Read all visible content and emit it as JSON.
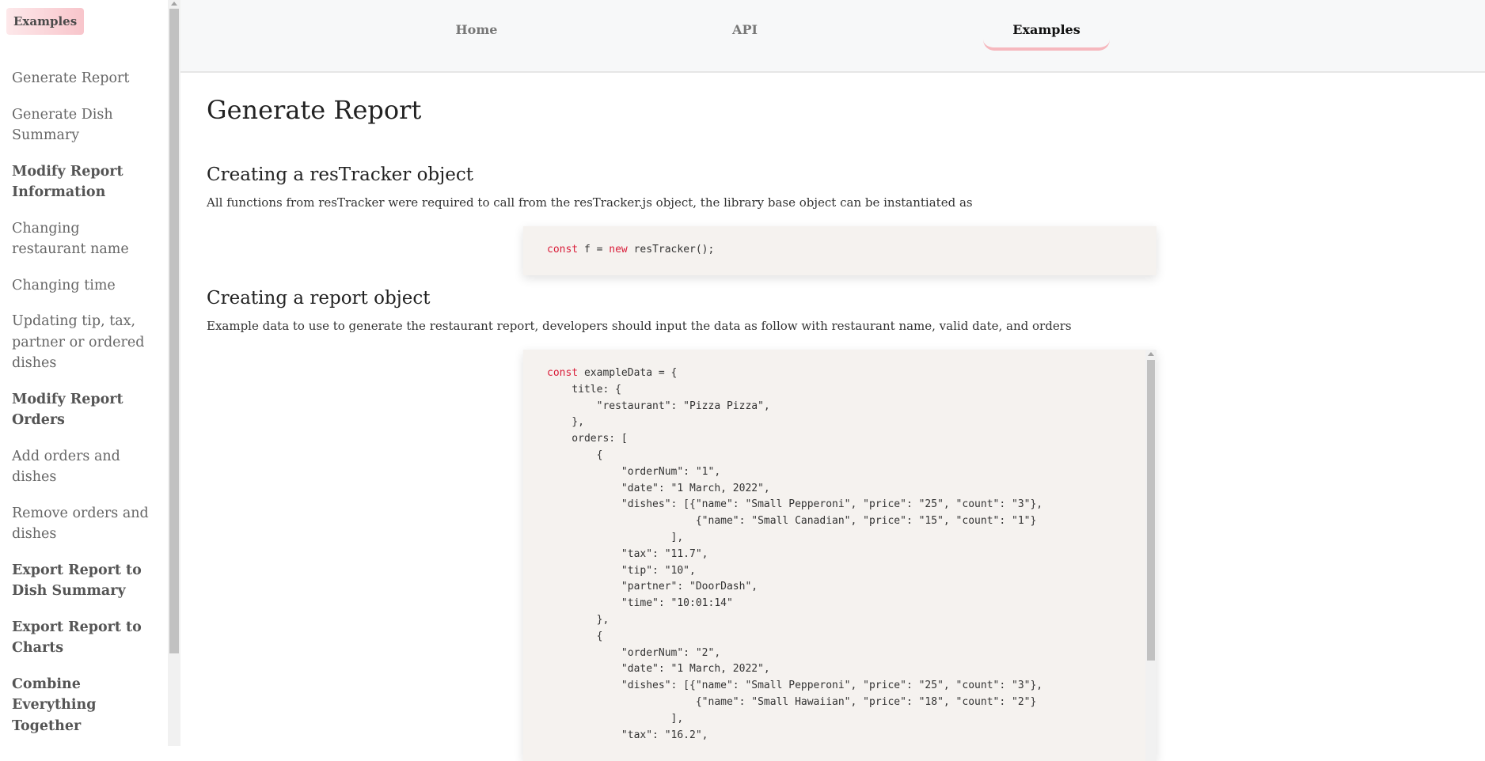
{
  "sidebar": {
    "badge": "Examples",
    "items": [
      {
        "label": "Generate Report",
        "section": false
      },
      {
        "label": "Generate Dish Summary",
        "section": false
      },
      {
        "label": "Modify Report Information",
        "section": true
      },
      {
        "label": "Changing restaurant name",
        "section": false
      },
      {
        "label": "Changing time",
        "section": false
      },
      {
        "label": "Updating tip, tax, partner or ordered dishes",
        "section": false
      },
      {
        "label": "Modify Report Orders",
        "section": true
      },
      {
        "label": "Add orders and dishes",
        "section": false
      },
      {
        "label": "Remove orders and dishes",
        "section": false
      },
      {
        "label": "Export Report to Dish Summary",
        "section": true
      },
      {
        "label": "Export Report to Charts",
        "section": true
      },
      {
        "label": "Combine Everything Together",
        "section": true
      }
    ]
  },
  "nav": {
    "tabs": [
      {
        "label": "Home",
        "active": false
      },
      {
        "label": "API",
        "active": false
      },
      {
        "label": "Examples",
        "active": true
      }
    ]
  },
  "main": {
    "title": "Generate Report",
    "section1": {
      "heading": "Creating a resTracker object",
      "text": "All functions from resTracker were required to call from the resTracker.js object, the library base object can be instantiated as",
      "code": "const f = new resTracker();"
    },
    "section2": {
      "heading": "Creating a report object",
      "text": "Example data to use to generate the restaurant report, developers should input the data as follow with restaurant name, valid date, and orders",
      "code": "const exampleData = {\n    title: {\n        \"restaurant\": \"Pizza Pizza\",\n    },\n    orders: [\n        {\n            \"orderNum\": \"1\",\n            \"date\": \"1 March, 2022\",\n            \"dishes\": [{\"name\": \"Small Pepperoni\", \"price\": \"25\", \"count\": \"3\"},\n                        {\"name\": \"Small Canadian\", \"price\": \"15\", \"count\": \"1\"}\n                    ],\n            \"tax\": \"11.7\",\n            \"tip\": \"10\",\n            \"partner\": \"DoorDash\",\n            \"time\": \"10:01:14\"\n        },\n        {\n            \"orderNum\": \"2\",\n            \"date\": \"1 March, 2022\",\n            \"dishes\": [{\"name\": \"Small Pepperoni\", \"price\": \"25\", \"count\": \"3\"},\n                        {\"name\": \"Small Hawaiian\", \"price\": \"18\", \"count\": \"2\"}\n                    ],\n            \"tax\": \"16.2\","
    }
  },
  "colors": {
    "accent": "#f6b8be",
    "keyword": "#d91e3a",
    "code_bg": "#f5f2ef"
  }
}
